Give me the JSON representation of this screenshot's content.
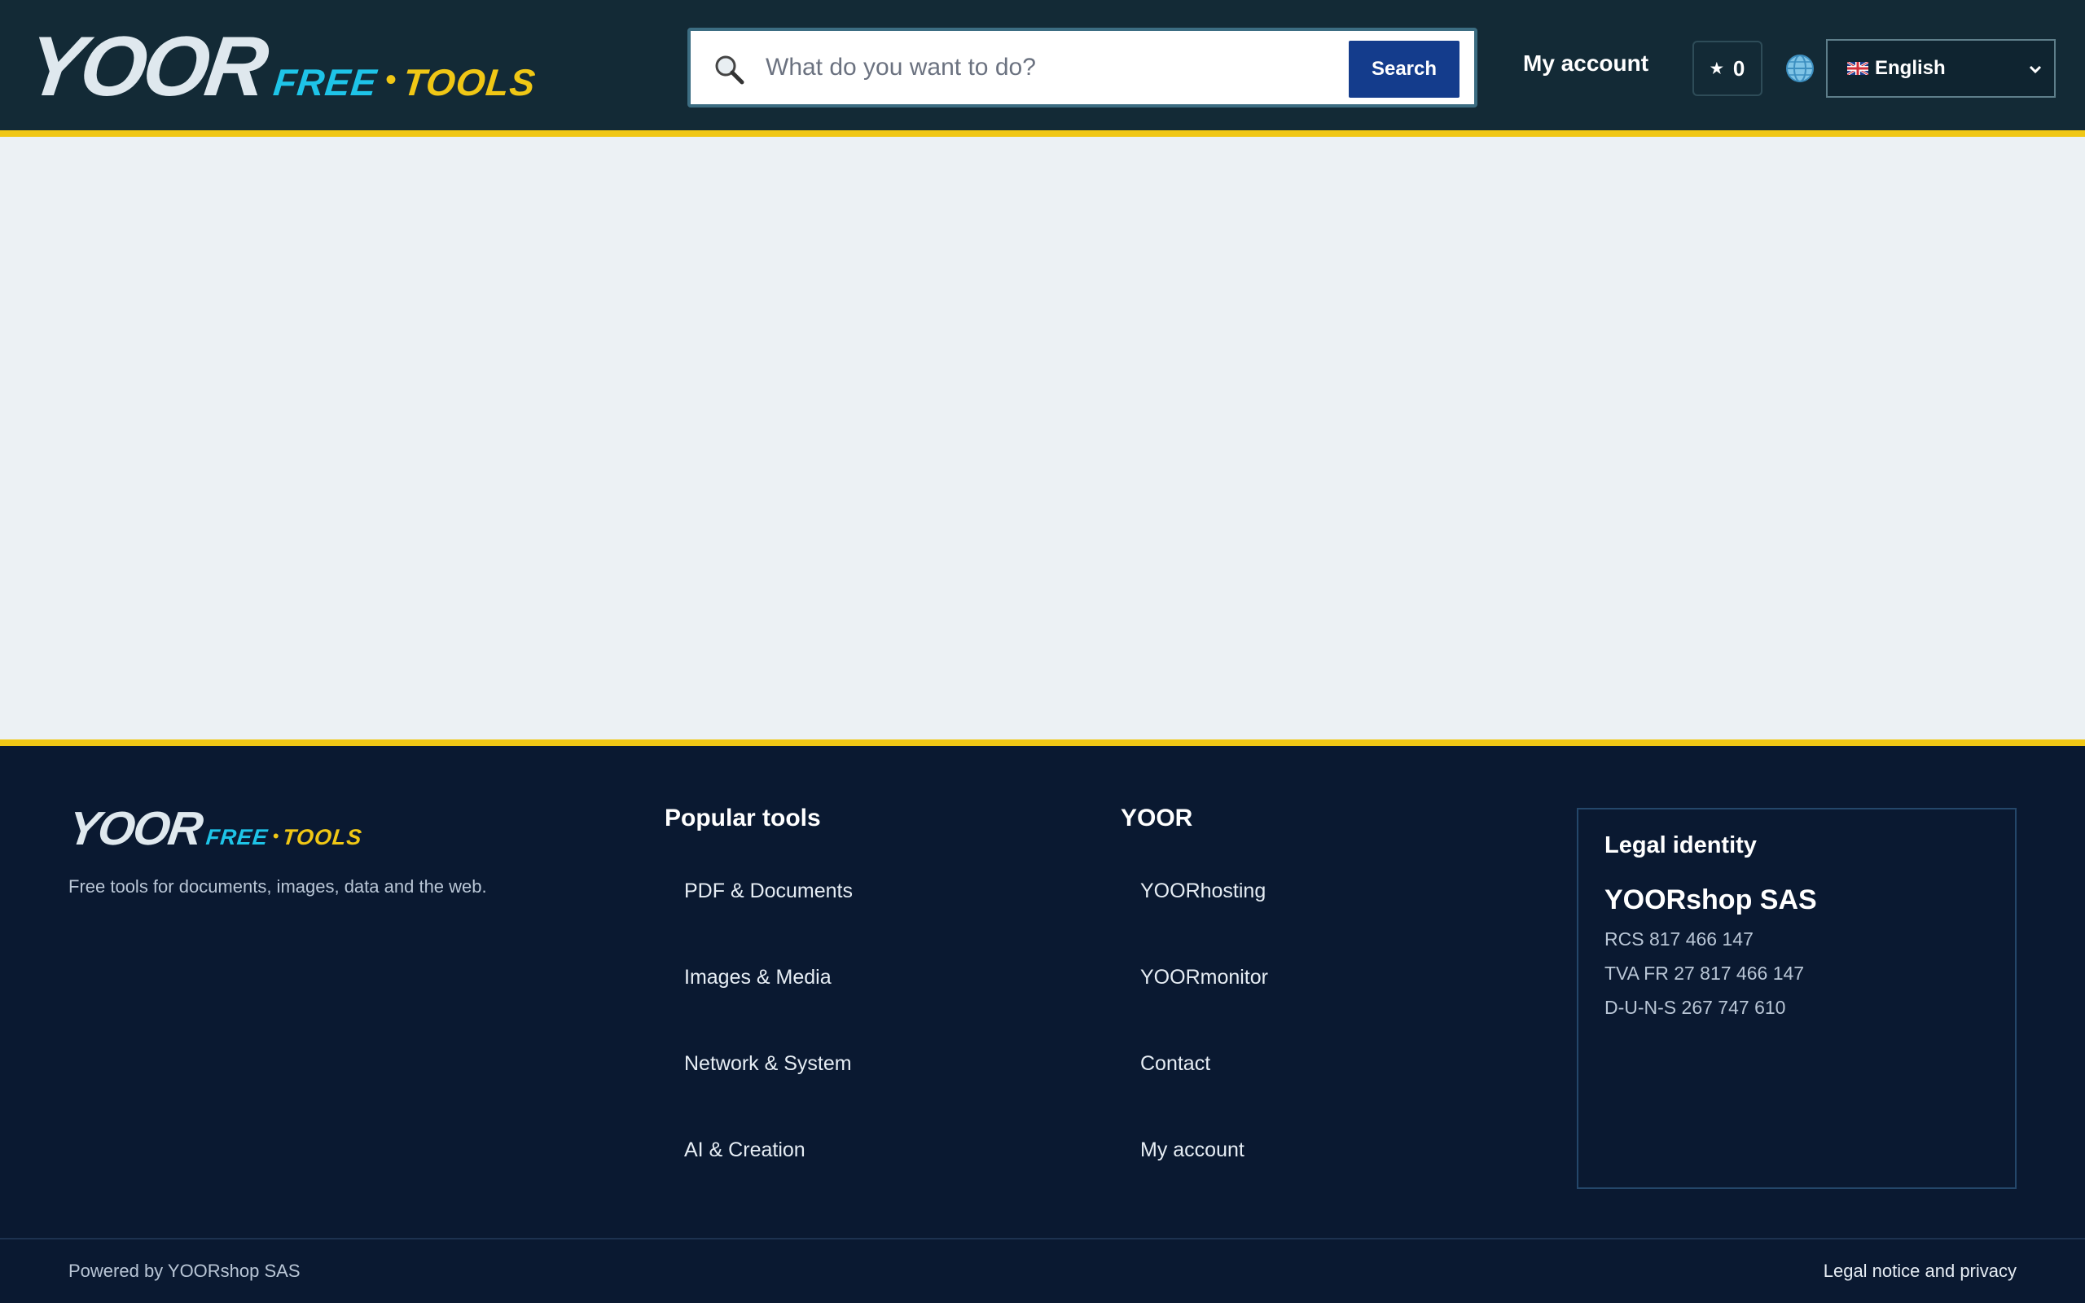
{
  "header": {
    "logo": {
      "main": "YOOR",
      "free": "FREE",
      "dot": "•",
      "tools": "TOOLS"
    },
    "search": {
      "placeholder": "What do you want to do?",
      "button_label": "Search",
      "icon": "magnifier-icon"
    },
    "my_account_label": "My account",
    "favorites": {
      "icon": "★",
      "count": "0"
    },
    "language": {
      "icon": "globe-icon",
      "flag": "uk-flag-icon",
      "selected": "English"
    }
  },
  "footer": {
    "logo": {
      "main": "YOOR",
      "free": "FREE",
      "dot": "•",
      "tools": "TOOLS"
    },
    "tagline": "Free tools for documents, images, data and the web.",
    "popular_tools": {
      "title": "Popular tools",
      "links": [
        "PDF & Documents",
        "Images & Media",
        "Network & System",
        "AI & Creation"
      ]
    },
    "yoor": {
      "title": "YOOR",
      "links": [
        "YOORhosting",
        "YOORmonitor",
        "Contact",
        "My account"
      ]
    },
    "legal": {
      "title": "Legal identity",
      "company": "YOORshop SAS",
      "lines": [
        "RCS 817 466 147",
        "TVA FR 27 817 466 147",
        "D-U-N-S 267 747 610"
      ]
    },
    "powered_by": "Powered by YOORshop SAS",
    "legal_notice": "Legal notice and privacy"
  },
  "colors": {
    "header_bg": "#132a36",
    "accent_yellow": "#f0c715",
    "accent_cyan": "#1ec4e8",
    "footer_bg": "#0a1931",
    "search_button": "#143c8c",
    "page_bg": "#ecf1f4"
  }
}
